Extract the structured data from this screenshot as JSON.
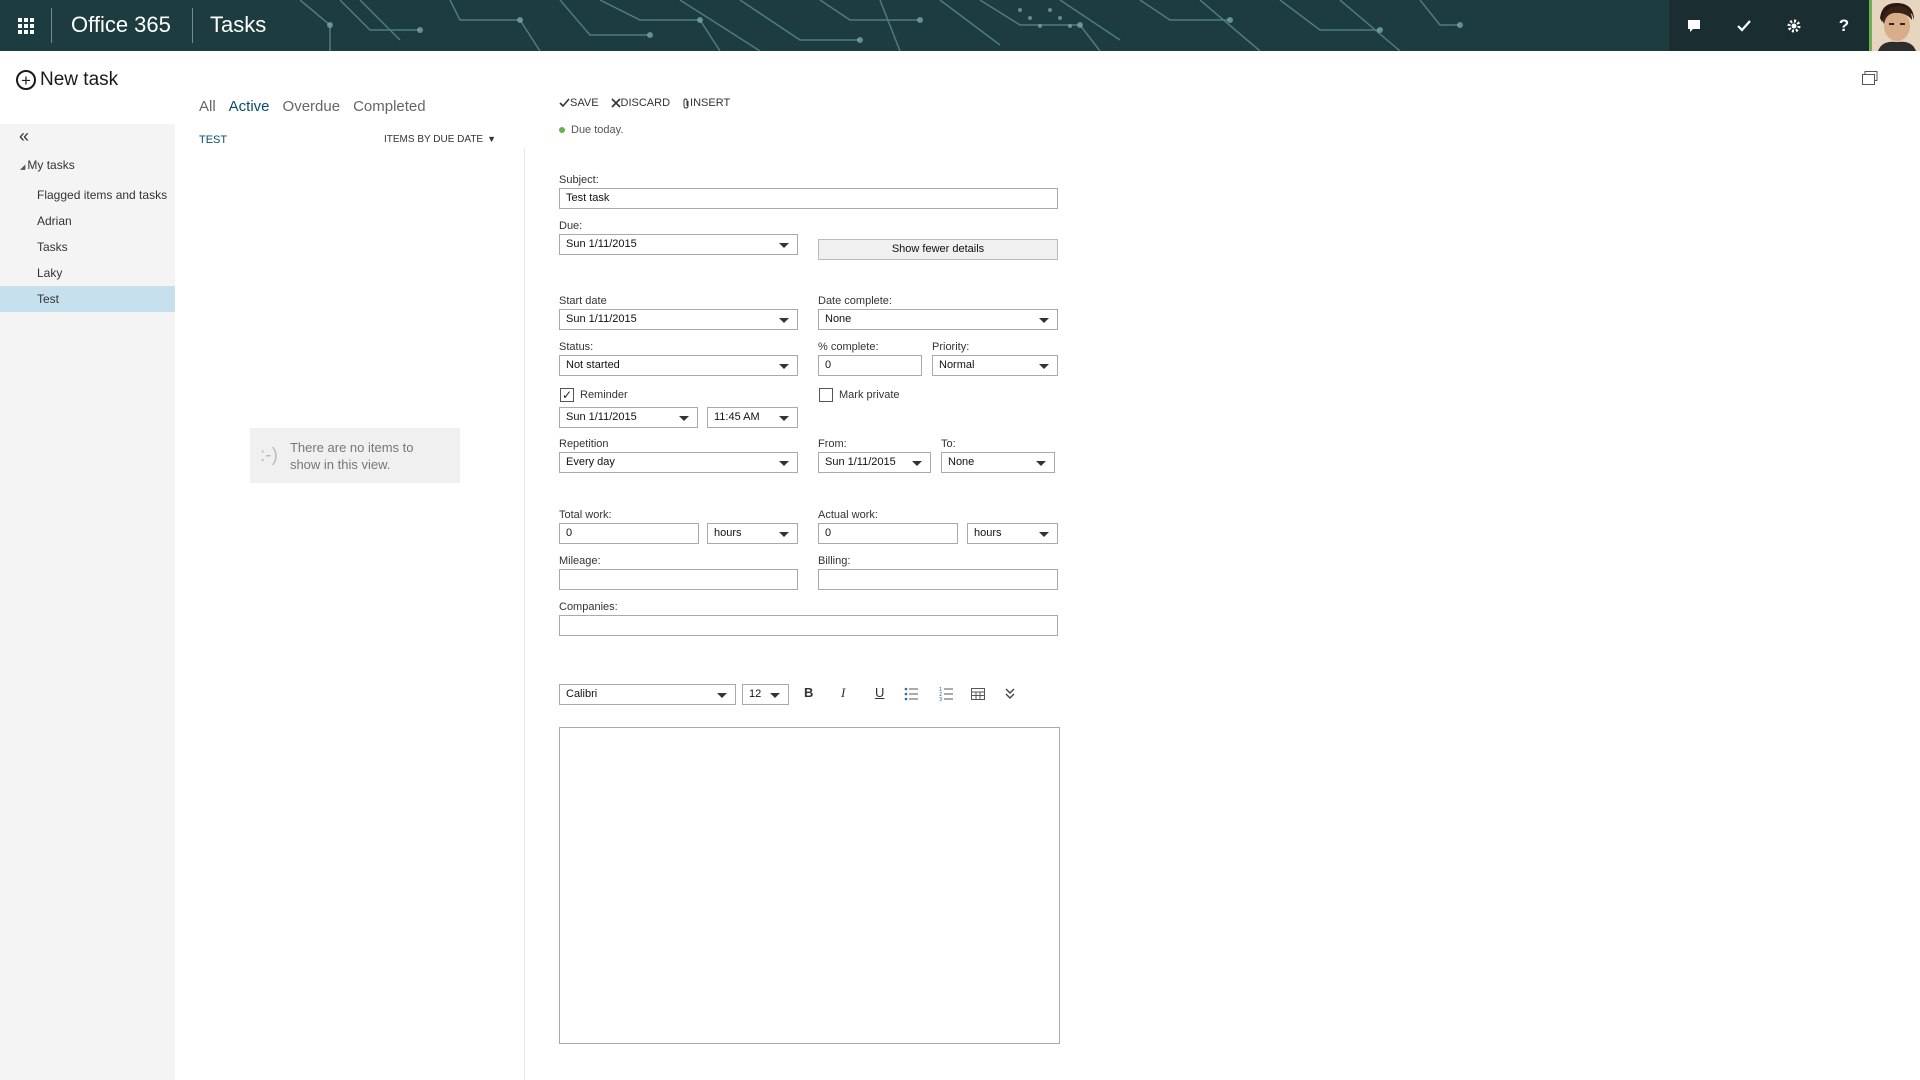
{
  "header": {
    "app_name": "Office 365",
    "module_name": "Tasks",
    "icons": [
      "waffle-icon",
      "chat-icon",
      "checkmark-icon",
      "gear-icon",
      "help-icon"
    ],
    "help_label": "?",
    "colors": {
      "bar": "#1d3c40",
      "accent": "#0a4d6e",
      "selected": "#c7e0ed",
      "status": "#6ab04c"
    }
  },
  "nav": {
    "new_task_label": "New task",
    "collapse_label": "«",
    "my_tasks_label": "My tasks",
    "items": [
      {
        "label": "Flagged items and tasks"
      },
      {
        "label": "Adrian"
      },
      {
        "label": "Tasks"
      },
      {
        "label": "Laky"
      },
      {
        "label": "Test",
        "selected": true
      }
    ]
  },
  "list": {
    "filters": [
      "All",
      "Active",
      "Overdue",
      "Completed"
    ],
    "active_filter": "Active",
    "name": "TEST",
    "sort_label": "ITEMS BY DUE DATE",
    "empty_face": ":-)",
    "empty_message": "There are no items to show in this view."
  },
  "editor": {
    "toolbar": {
      "save": "SAVE",
      "discard": "DISCARD",
      "insert": "INSERT"
    },
    "due_status": "Due today.",
    "subject": {
      "label": "Subject:",
      "value": "Test task"
    },
    "due": {
      "label": "Due:",
      "value": "Sun 1/11/2015"
    },
    "show_fewer_label": "Show fewer details",
    "start_date": {
      "label": "Start date",
      "value": "Sun 1/11/2015"
    },
    "date_complete": {
      "label": "Date complete:",
      "value": "None"
    },
    "status": {
      "label": "Status:",
      "value": "Not started"
    },
    "percent_complete": {
      "label": "% complete:",
      "value": "0"
    },
    "priority": {
      "label": "Priority:",
      "value": "Normal"
    },
    "reminder": {
      "label": "Reminder",
      "checked": true,
      "date": "Sun 1/11/2015",
      "time": "11:45 AM"
    },
    "mark_private": {
      "label": "Mark private",
      "checked": false
    },
    "repetition": {
      "label": "Repetition",
      "value": "Every day"
    },
    "from": {
      "label": "From:",
      "value": "Sun 1/11/2015"
    },
    "to": {
      "label": "To:",
      "value": "None"
    },
    "total_work": {
      "label": "Total work:",
      "value": "0",
      "unit": "hours"
    },
    "actual_work": {
      "label": "Actual work:",
      "value": "0",
      "unit": "hours"
    },
    "mileage": {
      "label": "Mileage:",
      "value": ""
    },
    "billing": {
      "label": "Billing:",
      "value": ""
    },
    "companies": {
      "label": "Companies:",
      "value": ""
    },
    "format": {
      "font": "Calibri",
      "size": "12",
      "bold": "B",
      "italic": "I",
      "underline": "U"
    }
  }
}
